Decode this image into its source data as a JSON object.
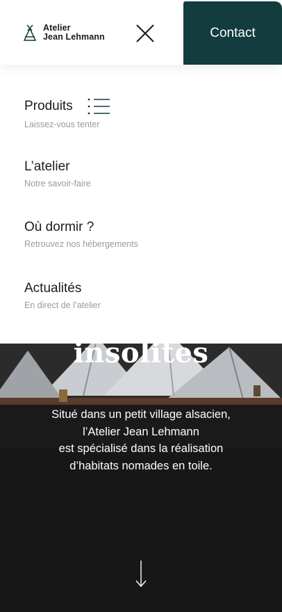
{
  "header": {
    "logo_line1": "Atelier",
    "logo_line2": "Jean Lehmann",
    "contact_label": "Contact",
    "accent_color": "#123c3e"
  },
  "menu": {
    "items": [
      {
        "title": "Produits",
        "subtitle": "Laissez-vous tenter",
        "icon": "list-icon"
      },
      {
        "title": "L’atelier",
        "subtitle": "Notre savoir-faire"
      },
      {
        "title": "Où dormir ?",
        "subtitle": "Retrouvez nos hébergements"
      },
      {
        "title": "Actualités",
        "subtitle": "En direct de l’atelier"
      }
    ]
  },
  "hero": {
    "title": "insolites",
    "lines": [
      "Situé dans un petit village alsacien,",
      "l’Atelier Jean Lehmann",
      "est spécialisé dans la réalisation",
      "d’habitats nomades en toile."
    ],
    "scroll_icon": "arrow-down-icon"
  }
}
